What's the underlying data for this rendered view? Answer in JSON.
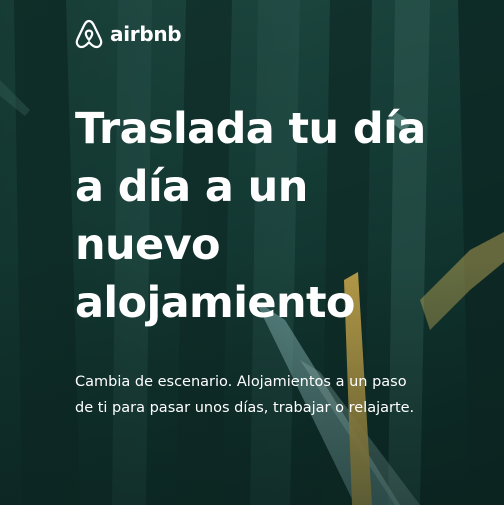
{
  "brand": {
    "name": "airbnb",
    "logo_icon": "airbnb-belo-icon",
    "color": "#ffffff"
  },
  "hero": {
    "headline_lines": [
      "Traslada tu día",
      "a día a un",
      "nuevo",
      "alojamiento"
    ],
    "subtext_lines": [
      "Cambia de escenario. Alojamientos a un paso",
      "de ti para pasar unos días, trabajar o relajarte."
    ],
    "background": "dark-green-illustrated-forest",
    "accent_colors": [
      "#c9a64a",
      "#8fc0c0",
      "#163d37"
    ]
  }
}
